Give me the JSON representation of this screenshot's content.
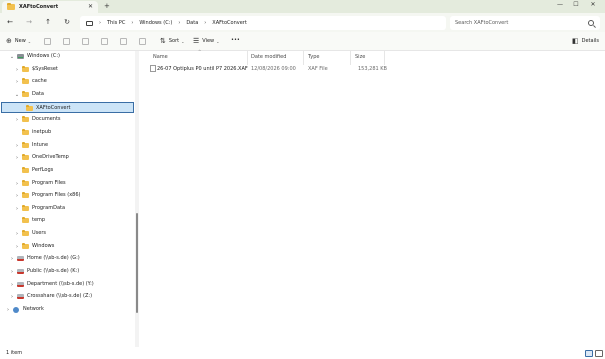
{
  "window": {
    "tab_title": "XAFtoConvert",
    "tab_close_glyph": "✕",
    "new_tab_glyph": "+",
    "minimize_glyph": "—",
    "maximize_glyph": "☐",
    "close_glyph": "✕"
  },
  "nav": {
    "back_glyph": "←",
    "forward_glyph": "→",
    "up_glyph": "↑",
    "refresh_glyph": "↻"
  },
  "address": {
    "separator": "›",
    "crumbs": [
      "This PC",
      "Windows (C:)",
      "Data",
      "XAFtoConvert"
    ]
  },
  "search": {
    "placeholder": "Search XAFtoConvert"
  },
  "toolbar": {
    "new_label": "New",
    "sort_label": "Sort",
    "view_label": "View",
    "more_label": "•••",
    "details_label": "Details",
    "caret": "⌄"
  },
  "tree": {
    "items": [
      {
        "label": "Windows (C:)",
        "chevron": "⌄",
        "icon": "drive-icon"
      },
      {
        "label": "$SysReset",
        "chevron": "›",
        "icon": "folder-icon"
      },
      {
        "label": "cache",
        "chevron": "›",
        "icon": "folder-icon"
      },
      {
        "label": "Data",
        "chevron": "⌄",
        "icon": "folder-icon"
      },
      {
        "label": "XAFtoConvert",
        "chevron": "",
        "icon": "folder-icon",
        "selected": true
      },
      {
        "label": "Documents",
        "chevron": "›",
        "icon": "folder-icon"
      },
      {
        "label": "inetpub",
        "chevron": "",
        "icon": "folder-icon"
      },
      {
        "label": "Intune",
        "chevron": "›",
        "icon": "folder-icon"
      },
      {
        "label": "OneDriveTemp",
        "chevron": "›",
        "icon": "folder-icon"
      },
      {
        "label": "PerfLogs",
        "chevron": "",
        "icon": "folder-icon"
      },
      {
        "label": "Program Files",
        "chevron": "›",
        "icon": "folder-icon"
      },
      {
        "label": "Program Files (x86)",
        "chevron": "›",
        "icon": "folder-icon"
      },
      {
        "label": "ProgramData",
        "chevron": "›",
        "icon": "folder-icon"
      },
      {
        "label": "temp",
        "chevron": "",
        "icon": "folder-icon"
      },
      {
        "label": "Users",
        "chevron": "›",
        "icon": "folder-icon"
      },
      {
        "label": "Windows",
        "chevron": "›",
        "icon": "folder-icon"
      },
      {
        "label": "Home (\\\\sb-s.de) (G:)",
        "chevron": "›",
        "icon": "network-drive-icon"
      },
      {
        "label": "Public (\\\\sb-s.de) (K:)",
        "chevron": "›",
        "icon": "network-drive-icon"
      },
      {
        "label": "Department (\\\\sb-s.de) (Y:)",
        "chevron": "›",
        "icon": "network-drive-icon"
      },
      {
        "label": "Crossshare (\\\\sb-s.de) (Z:)",
        "chevron": "›",
        "icon": "network-drive-icon"
      },
      {
        "label": "Network",
        "chevron": "›",
        "icon": "network-icon"
      }
    ]
  },
  "content": {
    "columns": {
      "name": "Name",
      "date": "Date modified",
      "type": "Type",
      "size": "Size"
    },
    "sort_indicator": "^",
    "files": [
      {
        "name": "26-07 Optiplus P0 until P7 2026.XAF",
        "date": "12/08/2026 09:00",
        "type": "XAF File",
        "size": "153,281 KB"
      }
    ]
  },
  "status": {
    "count_text": "1 item"
  }
}
